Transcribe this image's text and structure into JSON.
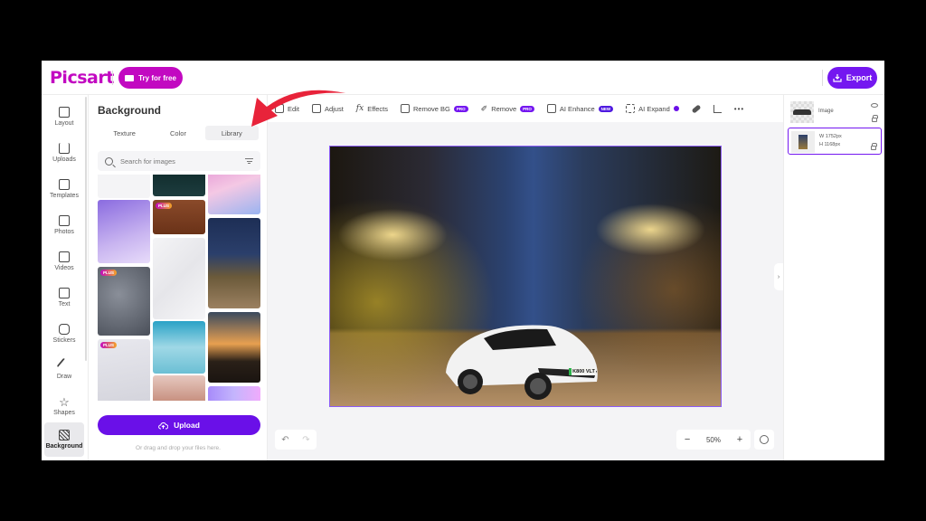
{
  "app": {
    "logo": "Picsart",
    "try_button": "Try for free",
    "export_button": "Export",
    "brand_color": "#c209c1",
    "accent_color": "#7417f0"
  },
  "rail": {
    "items": [
      {
        "label": "Layout",
        "icon": "layout-icon"
      },
      {
        "label": "Uploads",
        "icon": "upload-icon"
      },
      {
        "label": "Templates",
        "icon": "templates-icon"
      },
      {
        "label": "Photos",
        "icon": "photos-icon"
      },
      {
        "label": "Videos",
        "icon": "videos-icon"
      },
      {
        "label": "Text",
        "icon": "text-icon"
      },
      {
        "label": "Stickers",
        "icon": "stickers-icon"
      },
      {
        "label": "Draw",
        "icon": "brush-icon"
      },
      {
        "label": "Shapes",
        "icon": "star-icon"
      },
      {
        "label": "Background",
        "icon": "background-icon",
        "active": true
      }
    ]
  },
  "panel": {
    "title": "Background",
    "tabs": [
      "Texture",
      "Color",
      "Library"
    ],
    "active_tab": "Library",
    "search_placeholder": "Search for images",
    "plus_badge": "PLUS",
    "tiles": [
      {
        "desc": "purple clouds sky",
        "plus": false
      },
      {
        "desc": "snow on dark grey",
        "plus": true
      },
      {
        "desc": "white sand dunes",
        "plus": true
      },
      {
        "desc": "dark teal sparkles",
        "plus": false
      },
      {
        "desc": "brick wall",
        "plus": true
      },
      {
        "desc": "white marble",
        "plus": false
      },
      {
        "desc": "blue sky white clouds",
        "plus": false
      },
      {
        "desc": "vintage floral",
        "plus": false
      },
      {
        "desc": "pink clouds",
        "plus": false
      },
      {
        "desc": "night park path",
        "plus": false
      },
      {
        "desc": "sunset over sea",
        "plus": false
      },
      {
        "desc": "pastel gradient",
        "plus": false
      }
    ],
    "upload_button": "Upload",
    "drop_hint": "Or drag and drop your files here."
  },
  "toolbar": {
    "items": [
      {
        "label": "Edit",
        "icon": "edit-icon"
      },
      {
        "label": "Adjust",
        "icon": "adjust-icon"
      },
      {
        "label": "Effects",
        "icon": "fx-icon"
      },
      {
        "label": "Remove BG",
        "icon": "remove-bg-icon",
        "badge": "PRO"
      },
      {
        "label": "Remove",
        "icon": "eraser-icon",
        "badge": "PRO"
      },
      {
        "label": "AI Enhance",
        "icon": "enhance-icon",
        "badge": "NEW"
      },
      {
        "label": "AI Expand",
        "icon": "expand-icon",
        "badge_dot": true
      }
    ],
    "more": "•••"
  },
  "canvas": {
    "plate_text": "K800 VLT",
    "zoom_level": "50%",
    "zoom_minus": "−",
    "zoom_plus": "+",
    "undo": "↶",
    "redo": "↷"
  },
  "layers": {
    "items": [
      {
        "name": "Image"
      },
      {
        "width": "W 1752px",
        "height": "H 1168px",
        "selected": true
      }
    ]
  }
}
